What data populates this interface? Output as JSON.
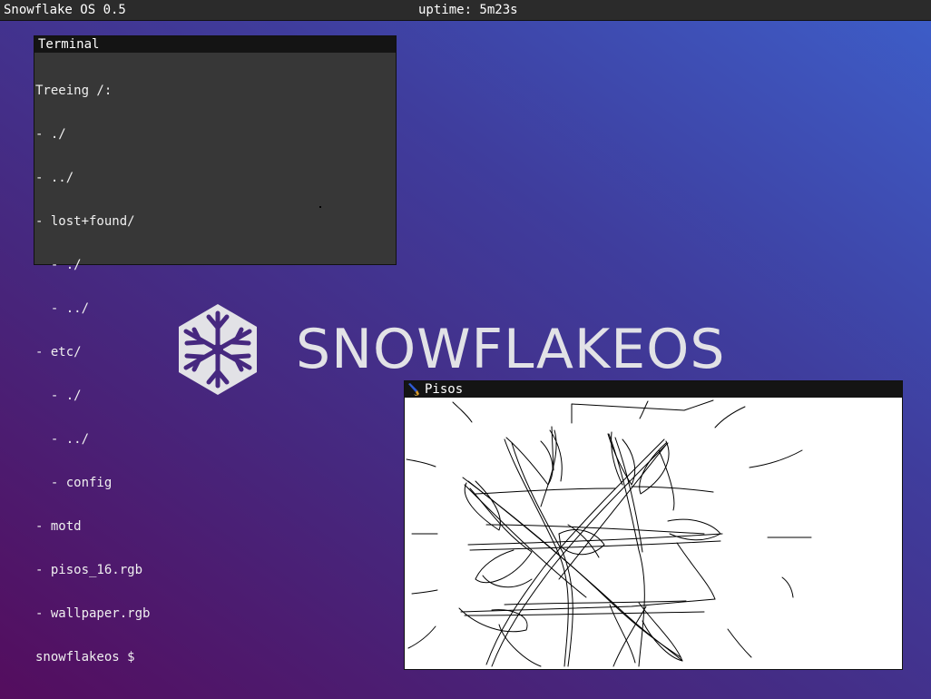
{
  "topbar": {
    "os_name": "Snowflake OS 0.5",
    "uptime": "uptime: 5m23s"
  },
  "wallpaper": {
    "brand_text": "SNOWFLAKEOS",
    "logo_icon": "snowflake-hexagon-icon"
  },
  "terminal": {
    "title": "Terminal",
    "lines": [
      "Treeing /:",
      "- ./",
      "- ../",
      "- lost+found/",
      "  - ./",
      "  - ../",
      "- etc/",
      "  - ./",
      "  - ../",
      "  - config",
      "- motd",
      "- pisos_16.rgb",
      "- wallpaper.rgb",
      "snowflakeos $"
    ]
  },
  "pisos": {
    "title": "Pisos",
    "icon": "paintbrush-icon"
  },
  "colors": {
    "topbar_bg": "#2b2b2b",
    "titlebar_bg": "#141414",
    "terminal_bg": "#373737",
    "canvas_bg": "#ffffff",
    "logo_text": "#e2e2e6"
  }
}
